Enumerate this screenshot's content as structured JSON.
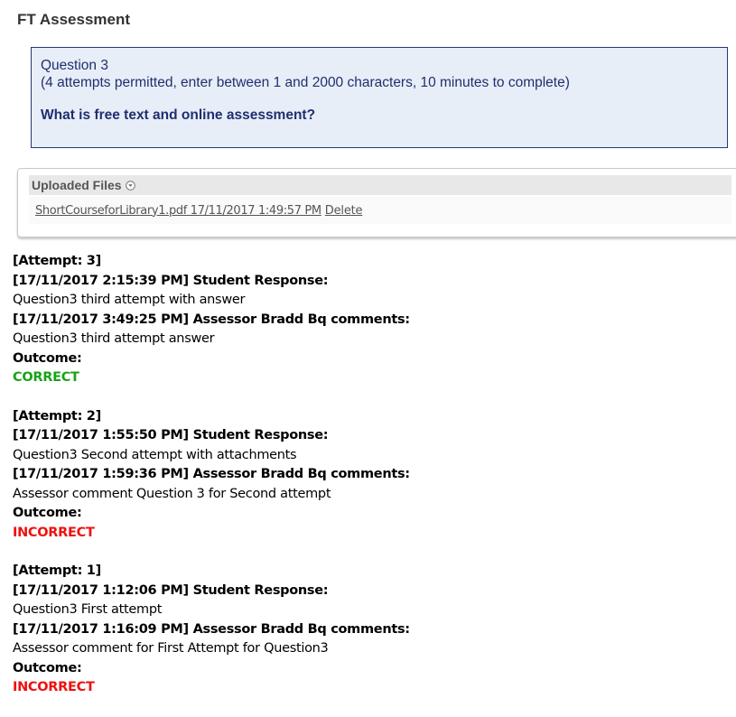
{
  "page": {
    "title": "FT Assessment"
  },
  "question": {
    "number_label": "Question 3",
    "constraints": "(4 attempts permitted, enter between 1 and 2000 characters, 10 minutes to complete)",
    "prompt": "What is free text and online assessment?"
  },
  "uploads": {
    "title": "Uploaded Files",
    "toggle_icon": "chevron-down-circle-icon",
    "files": [
      {
        "link_text": "ShortCourseforLibrary1.pdf 17/11/2017 1:49:57 PM",
        "delete_label": "Delete"
      }
    ]
  },
  "attempts": [
    {
      "header": "[Attempt: 3]",
      "response_label": "[17/11/2017 2:15:39 PM] Student Response:",
      "response_text": "Question3 third attempt with answer",
      "assessor_label": "[17/11/2017 3:49:25 PM] Assessor Bradd Bq comments:",
      "assessor_text": "Question3 third attempt answer",
      "outcome_label": "Outcome:",
      "outcome_value": "CORRECT",
      "outcome_color": "#19a319"
    },
    {
      "header": "[Attempt: 2]",
      "response_label": "[17/11/2017 1:55:50 PM] Student Response:",
      "response_text": "Question3 Second attempt with attachments",
      "assessor_label": "[17/11/2017 1:59:36 PM] Assessor Bradd Bq comments:",
      "assessor_text": "Assessor comment Question 3 for Second attempt",
      "outcome_label": "Outcome:",
      "outcome_value": "INCORRECT",
      "outcome_color": "#ee1111"
    },
    {
      "header": "[Attempt: 1]",
      "response_label": "[17/11/2017 1:12:06 PM] Student Response:",
      "response_text": "Question3 First attempt",
      "assessor_label": "[17/11/2017 1:16:09 PM] Assessor Bradd Bq comments:",
      "assessor_text": "Assessor comment for First Attempt for Question3",
      "outcome_label": "Outcome:",
      "outcome_value": "INCORRECT",
      "outcome_color": "#ee1111"
    }
  ]
}
